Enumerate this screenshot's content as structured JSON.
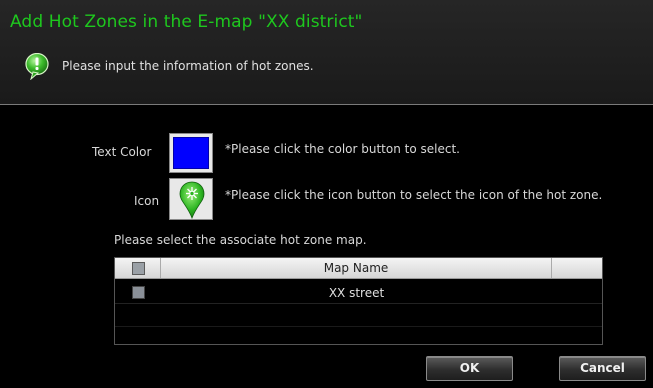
{
  "dialog": {
    "title": "Add Hot Zones in the E-map \"XX district\"",
    "subtitle": "Please input the information of hot zones.",
    "info_icon": "info-bubble-icon"
  },
  "form": {
    "text_color_label": "Text Color",
    "text_color_value": "#0000ff",
    "text_color_hint": "*Please click the color button to select.",
    "icon_label": "Icon",
    "icon_name": "green-pin-icon",
    "icon_hint": "*Please click the icon button to select the icon of the hot zone.",
    "map_select_label": "Please select the associate hot zone map."
  },
  "table": {
    "columns": [
      "Map Name"
    ],
    "rows": [
      {
        "name": "XX street",
        "checked": false
      }
    ]
  },
  "buttons": {
    "ok": "OK",
    "cancel": "Cancel"
  },
  "colors": {
    "title": "#1ec81e",
    "accent_green": "#2ecc40",
    "background": "#000000"
  }
}
